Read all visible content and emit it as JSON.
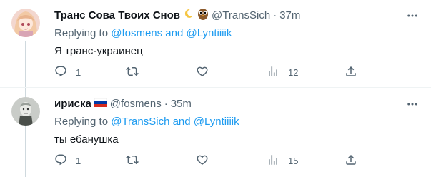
{
  "tweets": [
    {
      "display_name": "Транс Сова Твоих Снов",
      "name_emojis": [
        "crescent-moon-icon",
        "owl-icon"
      ],
      "handle": "@TransSich",
      "separator": "·",
      "time": "37m",
      "replying_prefix": "Replying to",
      "replying_users": "@fosmens and @Lyntiiiik",
      "text": "Я транс-украинец",
      "reply_count": "1",
      "retweet_count": "",
      "like_count": "",
      "view_count": "12"
    },
    {
      "display_name": "ириска",
      "name_emojis": [
        "russia-flag-icon"
      ],
      "handle": "@fosmens",
      "separator": "·",
      "time": "35m",
      "replying_prefix": "Replying to",
      "replying_users": "@TransSich and @Lyntiiiik",
      "text": "ты ебанушка",
      "reply_count": "1",
      "retweet_count": "",
      "like_count": "",
      "view_count": "15"
    }
  ],
  "colors": {
    "accent_link": "#1d9bf0",
    "secondary_text": "#536471",
    "primary_text": "#0f1419",
    "divider": "#eff3f4"
  }
}
